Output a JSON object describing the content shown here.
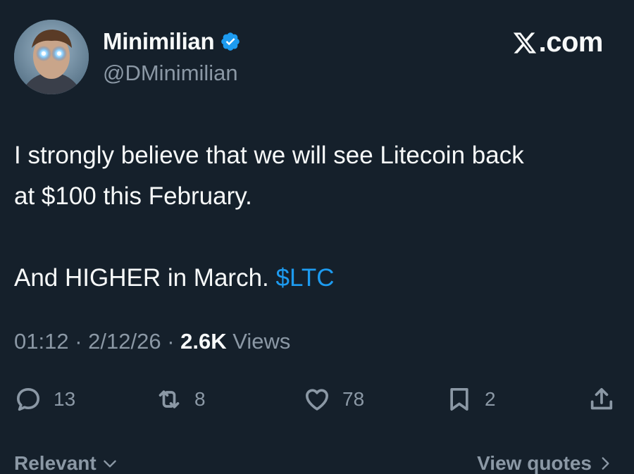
{
  "author": {
    "display_name": "Minimilian",
    "handle": "@DMinimilian",
    "verified_icon": "verified-badge-icon",
    "avatar_icon": "avatar-image"
  },
  "brand": {
    "label": ".com",
    "icon": "x-logo-icon"
  },
  "tweet": {
    "lines": [
      "I strongly believe that we will see Litecoin back",
      "at $100 this February."
    ],
    "line3_text": "And HIGHER in March. ",
    "cashtag": "$LTC"
  },
  "meta": {
    "time": "01:12",
    "sep1": " · ",
    "date": "2/12/26",
    "sep2": " · ",
    "views_count": "2.6K",
    "views_label": " Views"
  },
  "actions": {
    "replies": {
      "icon": "reply-icon",
      "count": "13"
    },
    "reposts": {
      "icon": "repost-icon",
      "count": "8"
    },
    "likes": {
      "icon": "heart-icon",
      "count": "78"
    },
    "bookmarks": {
      "icon": "bookmark-icon",
      "count": "2"
    },
    "share": {
      "icon": "share-icon"
    }
  },
  "footer": {
    "sort_label": "Relevant",
    "view_quotes_label": "View quotes"
  },
  "colors": {
    "background": "#15202b",
    "text_primary": "#f7f9f9",
    "text_secondary": "#8b98a5",
    "accent": "#1d9bf0"
  }
}
